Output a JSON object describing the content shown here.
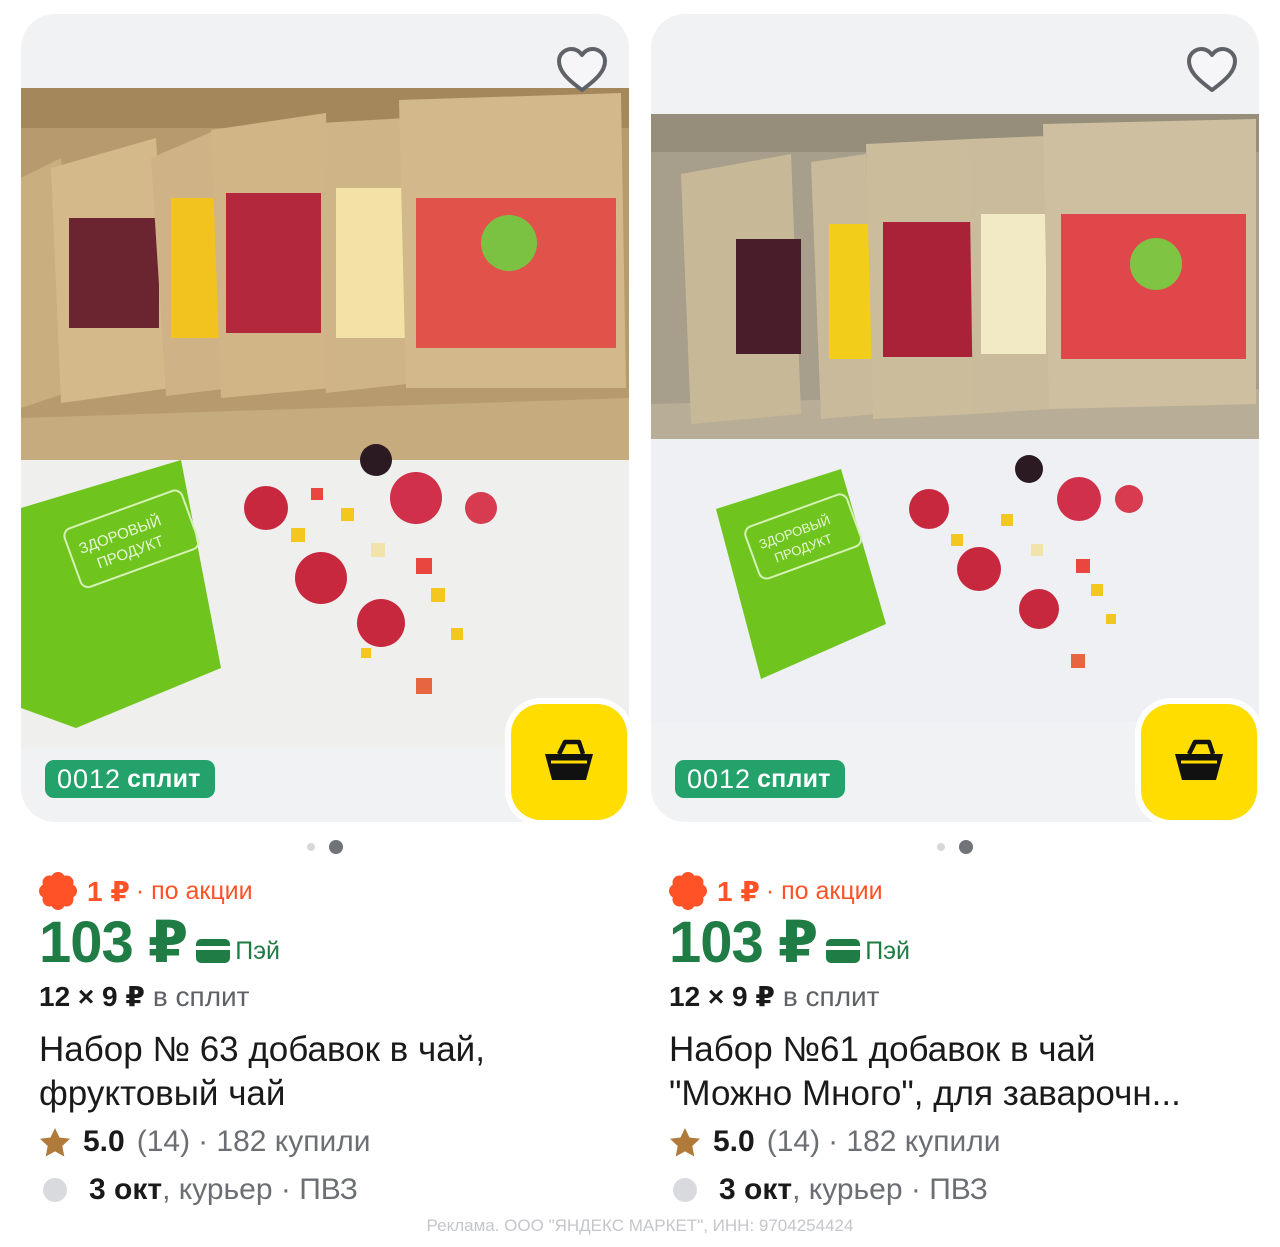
{
  "products": [
    {
      "split_badge": {
        "digits": "0012",
        "label": "сплит"
      },
      "promo": {
        "price": "1 ₽",
        "label": "· по акции"
      },
      "price": "103 ₽",
      "pay_label": "Пэй",
      "split_price": "12 × 9 ₽",
      "split_suffix": "в сплит",
      "title_line1": "Набор № 63 добавок в чай,",
      "title_line2": "фруктовый чай",
      "rating": "5.0",
      "reviews": "(14)",
      "bought": "· 182 купили",
      "delivery_date": "3 окт",
      "delivery_text": ", курьер · ПВЗ",
      "photo_label": "ЗДОРОВЫЙ ПРОДУКТ",
      "photo_label_line1": "ЗДОРОВЫЙ",
      "photo_label_line2": "ПРОДУКТ",
      "dots": {
        "total": 2,
        "active": 2
      }
    },
    {
      "split_badge": {
        "digits": "0012",
        "label": "сплит"
      },
      "promo": {
        "price": "1 ₽",
        "label": "· по акции"
      },
      "price": "103 ₽",
      "pay_label": "Пэй",
      "split_price": "12 × 9 ₽",
      "split_suffix": "в сплит",
      "title_line1": "Набор №61 добавок в чай",
      "title_line2": "\"Можно Много\", для заварочн...",
      "rating": "5.0",
      "reviews": "(14)",
      "bought": "· 182 купили",
      "delivery_date": "3 окт",
      "delivery_text": ", курьер · ПВЗ",
      "photo_label": "ЗДОРОВЫЙ ПРОДУКТ",
      "photo_label_line1": "ЗДОРОВЫЙ",
      "photo_label_line2": "ПРОДУКТ",
      "dots": {
        "total": 2,
        "active": 2
      }
    }
  ],
  "ad_disclaimer": "Реклама. ООО \"ЯНДЕКС МАРКЕТ\", ИНН: 9704254424",
  "colors": {
    "price_green": "#1e7c44",
    "promo_orange": "#ff5226",
    "split_green": "#23a26c",
    "cart_yellow": "#ffdd00",
    "star": "#b07a3a"
  },
  "icons": [
    "heart-icon",
    "cart-icon",
    "promo-flower-icon",
    "card-icon",
    "star-icon"
  ]
}
